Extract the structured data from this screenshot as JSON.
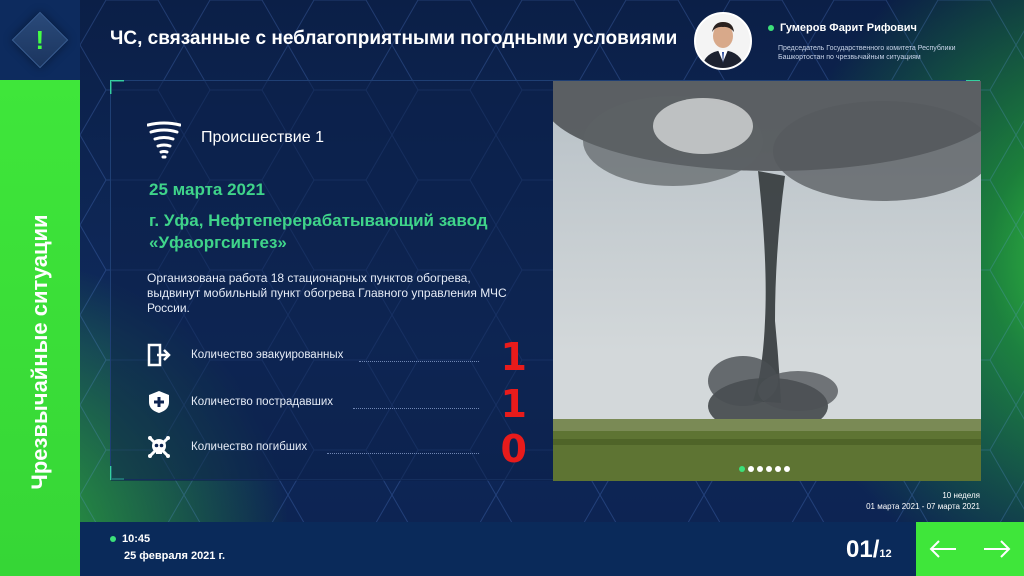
{
  "header": {
    "title": "ЧС, связанные с неблагоприятными погодными условиями"
  },
  "person": {
    "name": "Гумеров Фарит Рифович",
    "role": "Председатель Государственного комитета Республики Башкортостан по чрезвычайным ситуациям"
  },
  "sidebar": {
    "title": "Чрезвычайные ситуации"
  },
  "incident": {
    "title": "Происшествие 1",
    "date": "25 марта 2021",
    "place": "г. Уфа, Нефтеперерабатывающий завод «Уфаоргсинтез»",
    "description": "Организована работа 18 стационарных пунктов обогрева, выдвинут мобильный пункт обогрева Главного управления МЧС России.",
    "stats": [
      {
        "label": "Количество эвакуированных",
        "value": "1",
        "icon": "exit-door-icon"
      },
      {
        "label": "Количество пострадавших",
        "value": "1",
        "icon": "medical-shield-icon"
      },
      {
        "label": "Количество погибших",
        "value": "0",
        "icon": "skull-crossbones-icon"
      }
    ],
    "icon": "tornado-icon"
  },
  "gallery": {
    "image": "tornado-photo",
    "active_index": 0,
    "count": 6
  },
  "week": {
    "label": "10 неделя",
    "range": "01 марта 2021 - 07 марта 2021"
  },
  "footer": {
    "time": "10:45",
    "date": "25 февраля 2021 г.",
    "page_current": "01/",
    "page_total": "12"
  },
  "colors": {
    "accent_green": "#3fe63a",
    "text_green": "#3fd48a",
    "stat_red": "#e81b1b",
    "navy": "#0d2350"
  }
}
